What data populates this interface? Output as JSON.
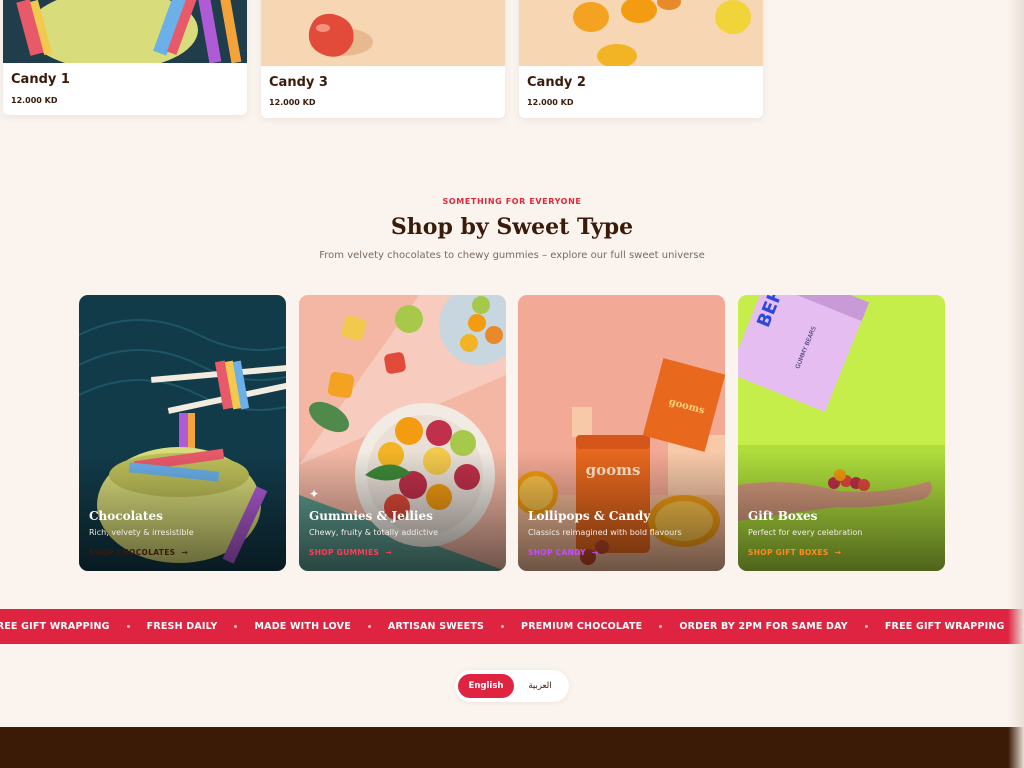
{
  "products": [
    {
      "name": "Candy 1",
      "price": "12.000 KD"
    },
    {
      "name": "Candy 3",
      "price": "12.000 KD"
    },
    {
      "name": "Candy 2",
      "price": "12.000 KD"
    }
  ],
  "section": {
    "eyebrow": "SOMETHING FOR EVERYONE",
    "title": "Shop by Sweet Type",
    "subtitle": "From velvety chocolates to chewy gummies – explore our full sweet universe"
  },
  "categories": [
    {
      "title": "Chocolates",
      "desc": "Rich, velvety & irresistible",
      "link": "SHOP CHOCOLATES",
      "link_color": "#3a1a0a"
    },
    {
      "title": "Gummies & Jellies",
      "desc": "Chewy, fruity & totally addictive",
      "link": "SHOP GUMMIES",
      "link_color": "#ff3d5a"
    },
    {
      "title": "Lollipops & Candy",
      "desc": "Classics reimagined with bold flavours",
      "link": "SHOP CANDY",
      "link_color": "#c64bff"
    },
    {
      "title": "Gift Boxes",
      "desc": "Perfect for every celebration",
      "link": "SHOP GIFT BOXES",
      "link_color": "#ff8a1f"
    }
  ],
  "marquee": [
    "FREE GIFT WRAPPING",
    "FRESH DAILY",
    "MADE WITH LOVE",
    "ARTISAN SWEETS",
    "PREMIUM CHOCOLATE",
    "ORDER BY 2PM FOR SAME DAY",
    "FREE GIFT WRAPPING"
  ],
  "language": {
    "english": "English",
    "arabic": "العربية"
  },
  "colors": {
    "accent": "#df2442",
    "brown": "#3b1a06",
    "background": "#fbf4ee"
  }
}
